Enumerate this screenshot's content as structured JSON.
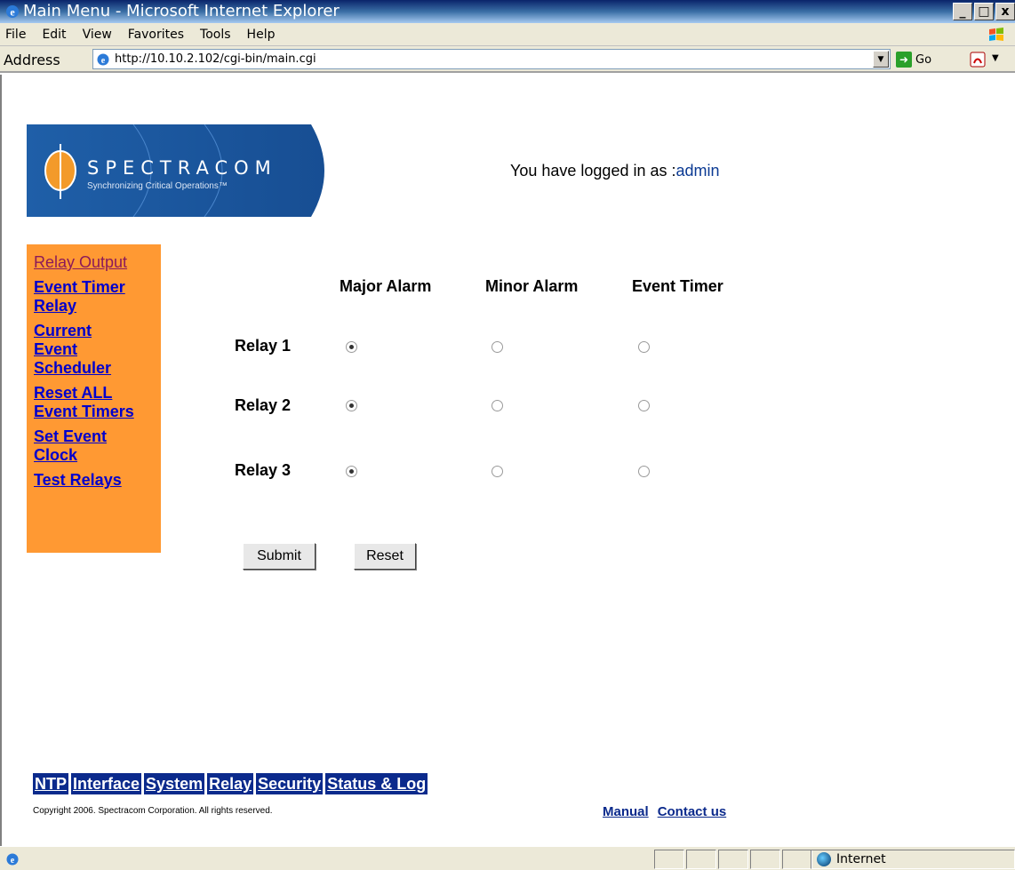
{
  "window": {
    "title": "Main Menu - Microsoft Internet Explorer",
    "minimize": "_",
    "maximize": "□",
    "close": "x"
  },
  "menubar": {
    "items": [
      "File",
      "Edit",
      "View",
      "Favorites",
      "Tools",
      "Help"
    ]
  },
  "addressbar": {
    "label": "Address",
    "url": "http://10.10.2.102/cgi-bin/main.cgi",
    "go_label": "Go"
  },
  "header": {
    "brand": "SPECTRACOM",
    "tagline": "Synchronizing Critical Operations™",
    "logged_in_prefix": "You have logged in as :",
    "username": "admin"
  },
  "sidenav": {
    "items": [
      "Relay Output",
      "Event Timer Relay",
      "Current Event Scheduler",
      "Reset ALL Event Timers",
      "Set Event Clock",
      "Test Relays"
    ]
  },
  "relay_form": {
    "columns": [
      "Major Alarm",
      "Minor Alarm",
      "Event Timer"
    ],
    "rows": [
      {
        "label": "Relay 1",
        "selected": "Major Alarm"
      },
      {
        "label": "Relay 2",
        "selected": "Major Alarm"
      },
      {
        "label": "Relay 3",
        "selected": "Major Alarm"
      }
    ],
    "submit_label": "Submit",
    "reset_label": "Reset"
  },
  "bottomnav": {
    "items": [
      "NTP",
      "Interface",
      "System",
      "Relay",
      "Security",
      "Status & Log"
    ]
  },
  "footer": {
    "copyright": "Copyright 2006. Spectracom Corporation. All rights reserved.",
    "manual": "Manual",
    "contact": "Contact us"
  },
  "statusbar": {
    "zone": "Internet"
  },
  "colors": {
    "sidenav_bg": "#ff9933",
    "link": "#0000cc",
    "visited_link": "#8b1a5a",
    "bottomnav_bg": "#0b2a8c",
    "logo_blue": "#1f5fa8"
  }
}
